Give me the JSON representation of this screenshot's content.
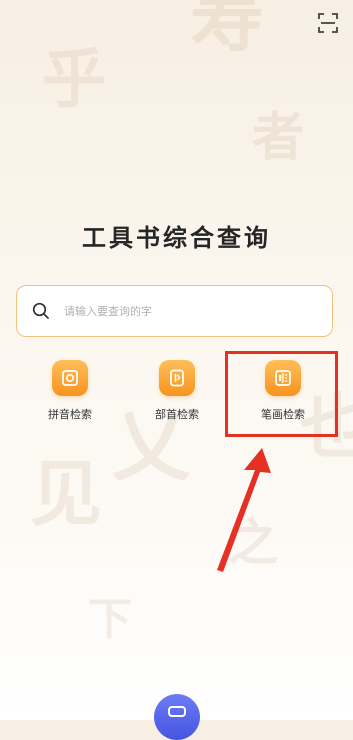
{
  "header": {
    "scan_icon": "scan-icon"
  },
  "background": {
    "chars": [
      "寿",
      "乎",
      "者",
      "乂",
      "也",
      "见",
      "之",
      "下"
    ],
    "color": "#af9169"
  },
  "main": {
    "title": "工具书综合查询",
    "search": {
      "placeholder": "请输入要查询的字",
      "value": "",
      "icon": "search-icon",
      "border_color": "#f2c27a"
    },
    "features": [
      {
        "label": "拼音检索",
        "icon": "pinyin-icon"
      },
      {
        "label": "部首检索",
        "icon": "radical-icon"
      },
      {
        "label": "笔画检索",
        "icon": "stroke-icon"
      }
    ],
    "accent_color": "#f7931e"
  },
  "annotation": {
    "highlight_color": "#e53023",
    "target": "笔画检索"
  },
  "bottom": {
    "badge_icon": "app-icon",
    "badge_color": "#4555e0"
  }
}
